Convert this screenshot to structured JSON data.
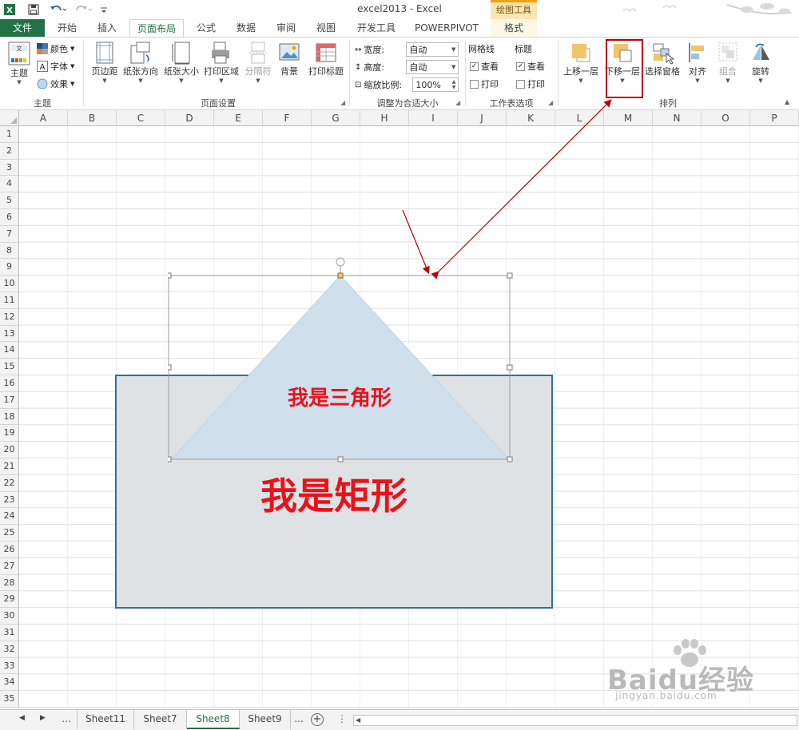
{
  "window": {
    "title": "excel2013 - Excel",
    "context_tab_group": "绘图工具"
  },
  "tabs": [
    {
      "label": "文件",
      "kind": "file"
    },
    {
      "label": "开始"
    },
    {
      "label": "插入"
    },
    {
      "label": "页面布局",
      "active": true
    },
    {
      "label": "公式"
    },
    {
      "label": "数据"
    },
    {
      "label": "审阅"
    },
    {
      "label": "视图"
    },
    {
      "label": "开发工具"
    },
    {
      "label": "POWERPIVOT"
    },
    {
      "label": "格式",
      "contextual": true
    }
  ],
  "ribbon": {
    "themes": {
      "group_label": "主题",
      "themes_button": "主题",
      "colors": "颜色",
      "fonts": "字体",
      "effects": "效果"
    },
    "page_setup": {
      "group_label": "页面设置",
      "margins": "页边距",
      "orientation": "纸张方向",
      "size": "纸张大小",
      "print_area": "打印区域",
      "breaks": "分隔符",
      "background": "背景",
      "print_titles": "打印标题"
    },
    "scale_to_fit": {
      "group_label": "调整为合适大小",
      "width_label": "宽度:",
      "width_value": "自动",
      "height_label": "高度:",
      "height_value": "自动",
      "scale_label": "缩放比例:",
      "scale_value": "100%"
    },
    "sheet_options": {
      "group_label": "工作表选项",
      "gridlines_label": "网格线",
      "headings_label": "标题",
      "view": "查看",
      "print": "打印",
      "gridlines_view_checked": true,
      "gridlines_print_checked": false,
      "headings_view_checked": true,
      "headings_print_checked": false
    },
    "arrange": {
      "group_label": "排列",
      "bring_forward": "上移一层",
      "send_backward": "下移一层",
      "selection_pane": "选择窗格",
      "align": "对齐",
      "group": "组合",
      "rotate": "旋转"
    }
  },
  "sheet": {
    "columns": [
      "A",
      "B",
      "C",
      "D",
      "E",
      "F",
      "G",
      "H",
      "I",
      "J",
      "K",
      "L",
      "M",
      "N",
      "O",
      "P"
    ],
    "rows": [
      "1",
      "2",
      "3",
      "4",
      "5",
      "6",
      "7",
      "8",
      "9",
      "10",
      "11",
      "12",
      "13",
      "14",
      "15",
      "16",
      "17",
      "18",
      "19",
      "20",
      "21",
      "22",
      "23",
      "24",
      "25",
      "26",
      "27",
      "28",
      "29",
      "30",
      "31",
      "32",
      "33",
      "34",
      "35"
    ]
  },
  "shapes": {
    "rectangle_text": "我是矩形",
    "triangle_text": "我是三角形",
    "rectangle_fill": "#dfe2e5",
    "rectangle_border": "#31728f",
    "triangle_fill": "#cfe0ec",
    "text_color": "#e8131a"
  },
  "annotations": {
    "highlight_color": "#c00000"
  },
  "sheet_tabs": {
    "more": "...",
    "tabs": [
      {
        "label": "Sheet11"
      },
      {
        "label": "Sheet7"
      },
      {
        "label": "Sheet8",
        "active": true
      },
      {
        "label": "Sheet9"
      }
    ],
    "more_right": "..."
  },
  "watermark": {
    "brand": "Baidu经验",
    "url": "jingyan.baidu.com"
  }
}
